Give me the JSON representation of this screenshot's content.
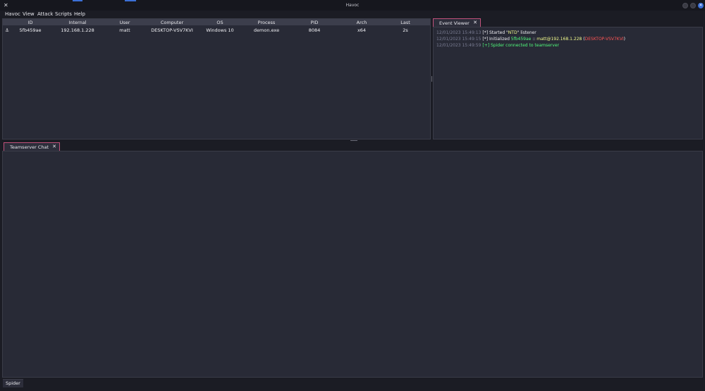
{
  "window": {
    "title": "Havoc",
    "app_icon": "havoc-logo-icon"
  },
  "menu": [
    "Havoc",
    "View",
    "Attack",
    "Scripts",
    "Help"
  ],
  "sessions": {
    "columns": [
      "ID",
      "Internal",
      "User",
      "Computer",
      "OS",
      "Process",
      "PID",
      "Arch",
      "Last"
    ],
    "rows": [
      {
        "icon": "agent-icon",
        "id": "5fb459ae",
        "internal": "192.168.1.228",
        "user": "matt",
        "computer": "DESKTOP-VSV7KVI",
        "os": "Windows 10",
        "process": "demon.exe",
        "pid": "8084",
        "arch": "x64",
        "last": "2s"
      }
    ]
  },
  "event_viewer": {
    "tab_label": "Event Viewer",
    "lines": [
      {
        "ts": "12/01/2023 15:49:13",
        "tag": "[*]",
        "pre": "Started \"",
        "name": "NTD",
        "post": "\" listener"
      },
      {
        "ts": "12/01/2023 15:49:15",
        "tag": "[*]",
        "pre": "Initialized ",
        "id": "5fb459ae",
        "mid": " :: ",
        "userhost": "matt@192.168.1.228",
        "open": " (",
        "host": "DESKTOP-VSV7KVI",
        "close": ")"
      },
      {
        "ts": "12/01/2023 15:49:59",
        "tag": "[+]",
        "msg": "Spider connected to teamserver"
      }
    ]
  },
  "chat": {
    "tab_label": "Teamserver Chat"
  },
  "status": {
    "user": "Spider"
  },
  "colors": {
    "accent": "#c1517b",
    "blue": "#3b6fd6",
    "green": "#50fa7b",
    "yellow": "#f1fa8c",
    "red": "#ff5555"
  }
}
